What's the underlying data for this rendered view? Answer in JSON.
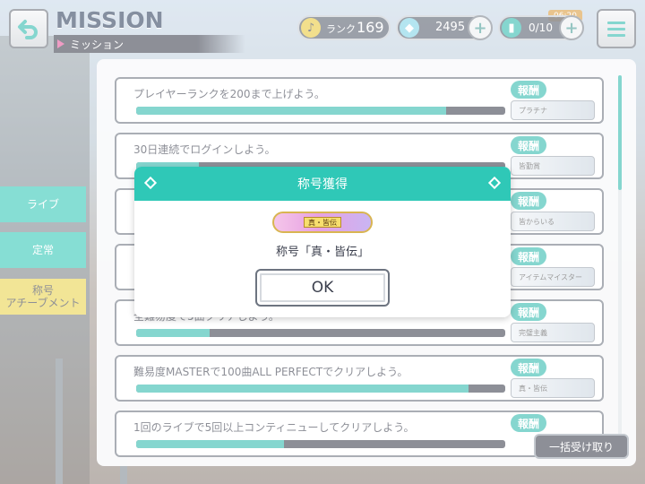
{
  "header": {
    "title": "MISSION",
    "subtitle": "ミッション",
    "rank_label": "ランク",
    "rank_value": "169",
    "gems": "2495",
    "timer": "06:20",
    "tickets": "0/10"
  },
  "tabs": {
    "live": "ライブ",
    "normal": "定常",
    "achievement_line1": "称号",
    "achievement_line2": "アチーブメント"
  },
  "missions": [
    {
      "text": "プレイヤーランクを200まで上げよう。",
      "progress": 0.84,
      "reward_label": "報酬",
      "reward": "プラチナ"
    },
    {
      "text": "30日連続でログインしよう。",
      "progress": 0.17,
      "reward_label": "報酬",
      "reward": "皆勤賞"
    },
    {
      "text": "",
      "progress": 0.5,
      "reward_label": "報酬",
      "reward": "皆からいる"
    },
    {
      "text": "",
      "progress": 0.5,
      "reward_label": "報酬",
      "reward": "アイテムマイスター"
    },
    {
      "text": "全難易度で5曲クリアしよう。",
      "progress": 0.2,
      "reward_label": "報酬",
      "reward": "完璧主義"
    },
    {
      "text": "難易度MASTERで100曲ALL PERFECTでクリアしよう。",
      "progress": 0.9,
      "reward_label": "報酬",
      "reward": "真・皆伝"
    },
    {
      "text": "1回のライブで5回以上コンティニューしてクリアしよう。",
      "progress": 0.4,
      "reward_label": "報酬",
      "reward": ""
    }
  ],
  "bulk_button": "一括受け取り",
  "modal": {
    "title": "称号獲得",
    "badge_text": "真・皆伝",
    "message": "称号「真・皆伝」",
    "ok": "OK"
  },
  "colors": {
    "accent": "#2fc8b7",
    "dark": "#3b3f4d"
  }
}
